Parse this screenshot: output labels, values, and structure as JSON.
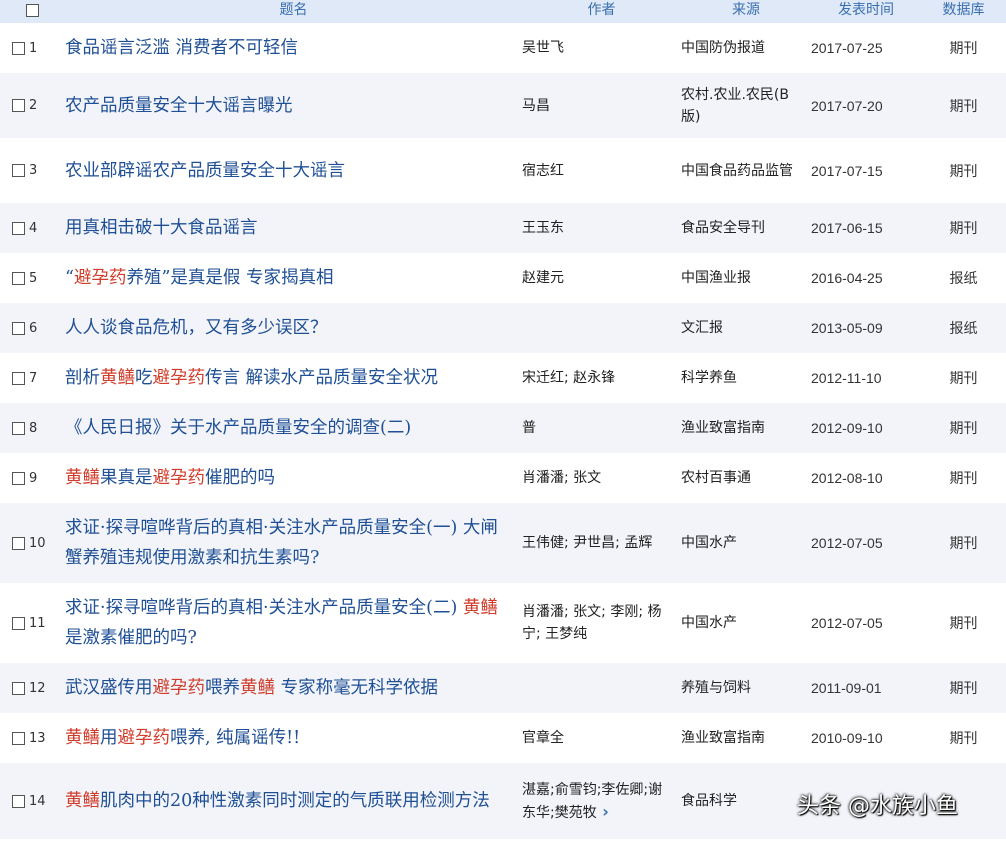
{
  "headers": {
    "select": "",
    "title": "题名",
    "author": "作者",
    "source": "来源",
    "date": "发表时间",
    "db": "数据库"
  },
  "rows": [
    {
      "num": "1",
      "title": [
        {
          "t": "食品谣言泛滥 消费者不可轻信"
        }
      ],
      "author": "吴世飞",
      "source": "中国防伪报道",
      "date": "2017-07-25",
      "db": "期刊"
    },
    {
      "num": "2",
      "title": [
        {
          "t": "农产品质量安全十大谣言曝光"
        }
      ],
      "author": "马昌",
      "source": "农村.农业.农民(B版)",
      "date": "2017-07-20",
      "db": "期刊"
    },
    {
      "num": "3",
      "title": [
        {
          "t": "农业部辟谣农产品质量安全十大谣言"
        }
      ],
      "author": "宿志红",
      "source": "中国食品药品监管",
      "date": "2017-07-15",
      "db": "期刊"
    },
    {
      "num": "4",
      "title": [
        {
          "t": "用真相击破十大食品谣言"
        }
      ],
      "author": "王玉东",
      "source": "食品安全导刊",
      "date": "2017-06-15",
      "db": "期刊"
    },
    {
      "num": "5",
      "title": [
        {
          "t": "“"
        },
        {
          "t": "避孕药",
          "hl": true
        },
        {
          "t": "养殖”是真是假 专家揭真相"
        }
      ],
      "author": "赵建元",
      "source": "中国渔业报",
      "date": "2016-04-25",
      "db": "报纸"
    },
    {
      "num": "6",
      "title": [
        {
          "t": "人人谈食品危机，又有多少误区？"
        }
      ],
      "author": "",
      "source": "文汇报",
      "date": "2013-05-09",
      "db": "报纸"
    },
    {
      "num": "7",
      "title": [
        {
          "t": "剖析"
        },
        {
          "t": "黄鳝",
          "hl": true
        },
        {
          "t": "吃"
        },
        {
          "t": "避孕药",
          "hl": true
        },
        {
          "t": "传言 解读水产品质量安全状况"
        }
      ],
      "author": "宋迁红; 赵永锋",
      "source": "科学养鱼",
      "date": "2012-11-10",
      "db": "期刊"
    },
    {
      "num": "8",
      "title": [
        {
          "t": "《人民日报》关于水产品质量安全的调查(二)"
        }
      ],
      "author": "普",
      "source": "渔业致富指南",
      "date": "2012-09-10",
      "db": "期刊"
    },
    {
      "num": "9",
      "title": [
        {
          "t": "黄鳝",
          "hl": true
        },
        {
          "t": "果真是"
        },
        {
          "t": "避孕药",
          "hl": true
        },
        {
          "t": "催肥的吗"
        }
      ],
      "author": "肖潘潘; 张文",
      "source": "农村百事通",
      "date": "2012-08-10",
      "db": "期刊"
    },
    {
      "num": "10",
      "title": [
        {
          "t": "求证·探寻喧哗背后的真相·关注水产品质量安全(一) 大闸蟹养殖违规使用激素和抗生素吗?"
        }
      ],
      "author": "王伟健; 尹世昌; 孟辉",
      "source": "中国水产",
      "date": "2012-07-05",
      "db": "期刊"
    },
    {
      "num": "11",
      "title": [
        {
          "t": "求证·探寻喧哗背后的真相·关注水产品质量安全(二) "
        },
        {
          "t": "黄鳝",
          "hl": true
        },
        {
          "t": "是激素催肥的吗?"
        }
      ],
      "author": "肖潘潘; 张文; 李刚; 杨宁; 王梦纯",
      "source": "中国水产",
      "date": "2012-07-05",
      "db": "期刊"
    },
    {
      "num": "12",
      "title": [
        {
          "t": "武汉盛传用"
        },
        {
          "t": "避孕药",
          "hl": true
        },
        {
          "t": "喂养"
        },
        {
          "t": "黄鳝",
          "hl": true
        },
        {
          "t": " 专家称毫无科学依据"
        }
      ],
      "author": "",
      "source": "养殖与饲料",
      "date": "2011-09-01",
      "db": "期刊"
    },
    {
      "num": "13",
      "title": [
        {
          "t": "黄鳝",
          "hl": true
        },
        {
          "t": "用"
        },
        {
          "t": "避孕药",
          "hl": true
        },
        {
          "t": "喂养, 纯属谣传!!"
        }
      ],
      "author": "官章全",
      "source": "渔业致富指南",
      "date": "2010-09-10",
      "db": "期刊"
    },
    {
      "num": "14",
      "title": [
        {
          "t": "黄鳝",
          "hl": true
        },
        {
          "t": "肌肉中的20种性激素同时测定的气质联用检测方法"
        }
      ],
      "author": "湛嘉;俞雪钧;李佐卿;谢东华;樊苑牧",
      "source": "食品科学",
      "date": "",
      "db": ""
    }
  ],
  "more_icon": "chevron-right-icon",
  "watermark": "头条 @水族小鱼"
}
